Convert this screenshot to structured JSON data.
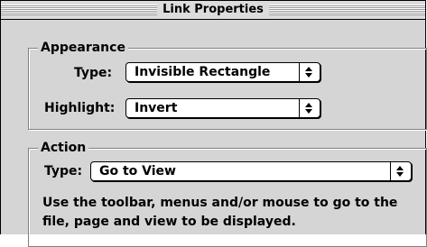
{
  "window": {
    "title": "Link Properties"
  },
  "appearance": {
    "group_label": "Appearance",
    "type_label": "Type:",
    "type_value": "Invisible Rectangle",
    "highlight_label": "Highlight:",
    "highlight_value": "Invert"
  },
  "action": {
    "group_label": "Action",
    "type_label": "Type:",
    "type_value": "Go to View",
    "description": "Use the toolbar, menus and/or mouse to go to the file, page and view to be displayed."
  },
  "icons": {
    "popup_arrows": "up-down-arrows-icon"
  }
}
